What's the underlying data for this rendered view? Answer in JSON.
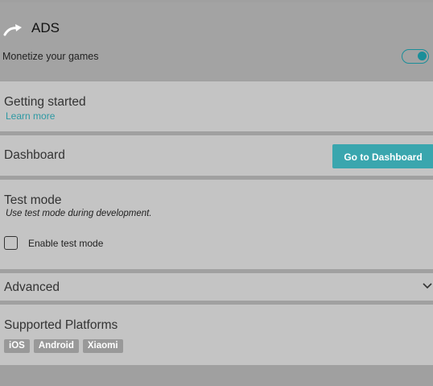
{
  "header": {
    "title": "ADS",
    "subtitle": "Monetize your games",
    "icon": "ads-arrow-icon",
    "toggle_on": true,
    "accent_color": "#1a8e99"
  },
  "getting_started": {
    "title": "Getting started",
    "link": "Learn more"
  },
  "dashboard": {
    "title": "Dashboard",
    "button": "Go to Dashboard"
  },
  "test_mode": {
    "title": "Test mode",
    "hint": "Use test mode during development.",
    "checkbox_label": "Enable test mode",
    "checked": false
  },
  "advanced": {
    "title": "Advanced",
    "expanded": false
  },
  "platforms": {
    "title": "Supported Platforms",
    "tags": [
      "iOS",
      "Android",
      "Xiaomi"
    ]
  }
}
